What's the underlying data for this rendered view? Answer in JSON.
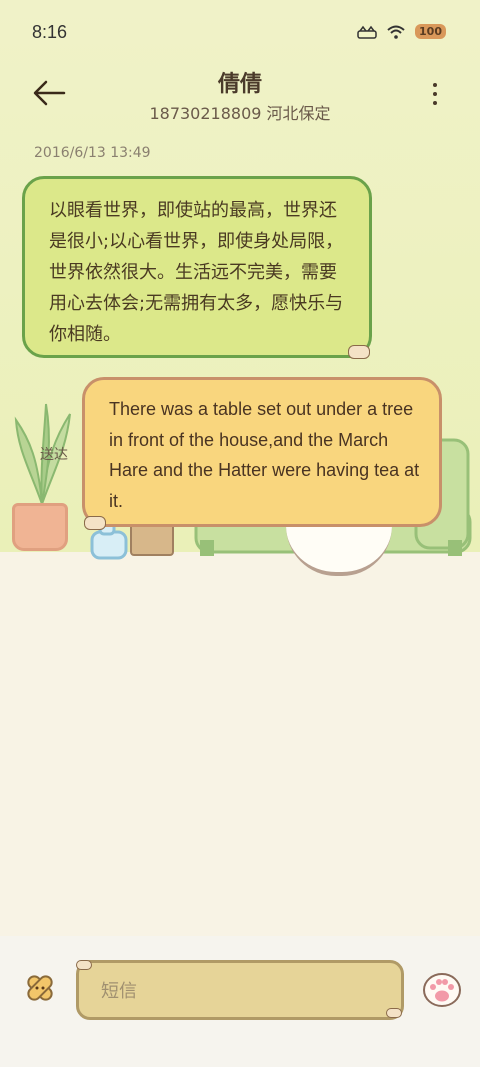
{
  "status_bar": {
    "time": "8:16",
    "battery": "100"
  },
  "header": {
    "contact_name": "倩倩",
    "subtitle": "18730218809 河北保定"
  },
  "conversation": {
    "timestamp": "2016/6/13 13:49",
    "messages": [
      {
        "direction": "incoming",
        "text": "以眼看世界，即使站的最高，世界还是很小;以心看世界，即使身处局限，世界依然很大。生活远不完美，需要用心去体会;无需拥有太多，愿快乐与你相随。"
      },
      {
        "direction": "outgoing",
        "text": "There was a table set out under a tree in front of the house,and the March Hare and the Hatter were having tea at it.",
        "status": "送达"
      }
    ]
  },
  "composer": {
    "placeholder": "短信"
  },
  "colors": {
    "incoming_bubble": "#dce88a",
    "incoming_border": "#6aa24a",
    "outgoing_bubble": "#f9d67e",
    "outgoing_border": "#c8906a",
    "background_top": "#eaf0b8",
    "floor": "#f8f3e5"
  },
  "icons": [
    "back-arrow-icon",
    "more-vert-icon",
    "sticker-icon",
    "paw-icon",
    "signal-icon",
    "wifi-icon"
  ]
}
